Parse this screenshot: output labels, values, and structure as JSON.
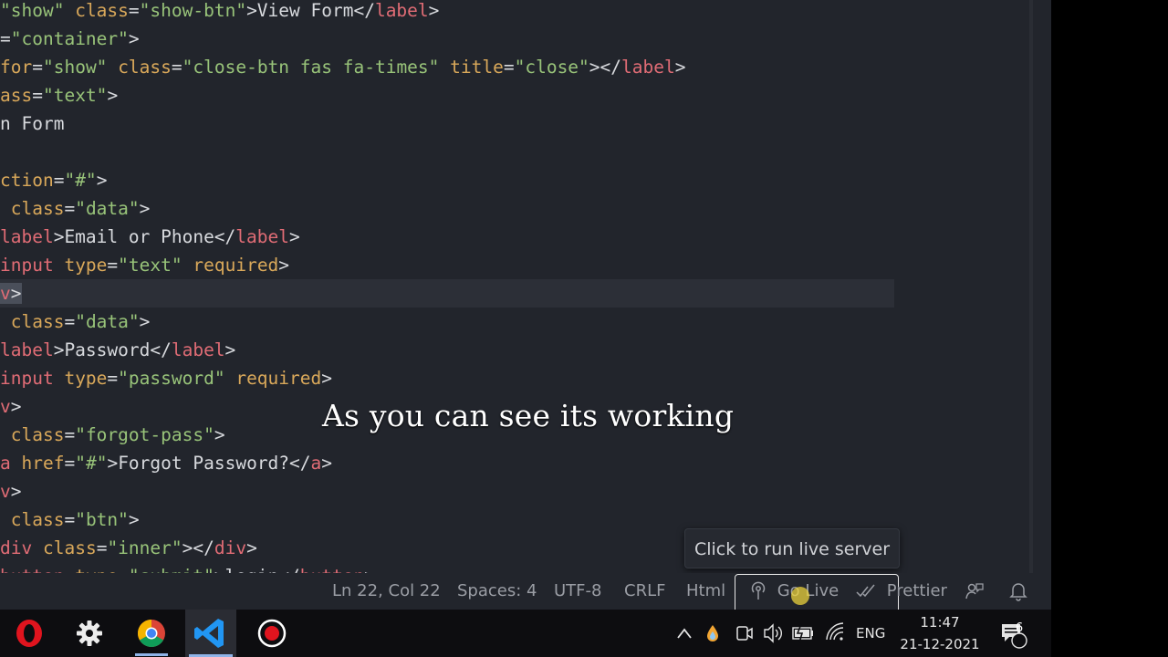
{
  "code_lines": [
    {
      "tokens": [
        {
          "c": "t-str",
          "t": "\"show\""
        },
        {
          "c": "t-txt",
          "t": " "
        },
        {
          "c": "t-attr",
          "t": "class"
        },
        {
          "c": "t-punc",
          "t": "="
        },
        {
          "c": "t-str",
          "t": "\"show-btn\""
        },
        {
          "c": "t-punc",
          "t": ">View Form</"
        },
        {
          "c": "t-tag",
          "t": "label"
        },
        {
          "c": "t-punc",
          "t": ">"
        }
      ]
    },
    {
      "tokens": [
        {
          "c": "t-punc",
          "t": "="
        },
        {
          "c": "t-str",
          "t": "\"container\""
        },
        {
          "c": "t-punc",
          "t": ">"
        }
      ]
    },
    {
      "tokens": [
        {
          "c": "t-attr",
          "t": "for"
        },
        {
          "c": "t-punc",
          "t": "="
        },
        {
          "c": "t-str",
          "t": "\"show\""
        },
        {
          "c": "t-txt",
          "t": " "
        },
        {
          "c": "t-attr",
          "t": "class"
        },
        {
          "c": "t-punc",
          "t": "="
        },
        {
          "c": "t-str",
          "t": "\"close-btn fas fa-times\""
        },
        {
          "c": "t-txt",
          "t": " "
        },
        {
          "c": "t-attr",
          "t": "title"
        },
        {
          "c": "t-punc",
          "t": "="
        },
        {
          "c": "t-str",
          "t": "\"close\""
        },
        {
          "c": "t-punc",
          "t": "></"
        },
        {
          "c": "t-tag",
          "t": "label"
        },
        {
          "c": "t-punc",
          "t": ">"
        }
      ]
    },
    {
      "tokens": [
        {
          "c": "t-attr",
          "t": "ass"
        },
        {
          "c": "t-punc",
          "t": "="
        },
        {
          "c": "t-str",
          "t": "\"text\""
        },
        {
          "c": "t-punc",
          "t": ">"
        }
      ]
    },
    {
      "tokens": [
        {
          "c": "t-txt",
          "t": "n Form"
        }
      ]
    },
    {
      "tokens": []
    },
    {
      "tokens": [
        {
          "c": "t-attr",
          "t": "ction"
        },
        {
          "c": "t-punc",
          "t": "="
        },
        {
          "c": "t-str",
          "t": "\"#\""
        },
        {
          "c": "t-punc",
          "t": ">"
        }
      ]
    },
    {
      "tokens": [
        {
          "c": "t-txt",
          "t": " "
        },
        {
          "c": "t-attr",
          "t": "class"
        },
        {
          "c": "t-punc",
          "t": "="
        },
        {
          "c": "t-str",
          "t": "\"data\""
        },
        {
          "c": "t-punc",
          "t": ">"
        }
      ]
    },
    {
      "tokens": [
        {
          "c": "t-tag",
          "t": "label"
        },
        {
          "c": "t-punc",
          "t": ">Email or Phone</"
        },
        {
          "c": "t-tag",
          "t": "label"
        },
        {
          "c": "t-punc",
          "t": ">"
        }
      ]
    },
    {
      "tokens": [
        {
          "c": "t-tag",
          "t": "input"
        },
        {
          "c": "t-txt",
          "t": " "
        },
        {
          "c": "t-attr",
          "t": "type"
        },
        {
          "c": "t-punc",
          "t": "="
        },
        {
          "c": "t-str",
          "t": "\"text\""
        },
        {
          "c": "t-txt",
          "t": " "
        },
        {
          "c": "t-attr",
          "t": "required"
        },
        {
          "c": "t-punc",
          "t": ">"
        }
      ]
    },
    {
      "active": true,
      "tokens": [
        {
          "c": "t-tag sel",
          "t": "v"
        },
        {
          "c": "t-punc sel",
          "t": ">"
        }
      ]
    },
    {
      "tokens": [
        {
          "c": "t-txt",
          "t": " "
        },
        {
          "c": "t-attr",
          "t": "class"
        },
        {
          "c": "t-punc",
          "t": "="
        },
        {
          "c": "t-str",
          "t": "\"data\""
        },
        {
          "c": "t-punc",
          "t": ">"
        }
      ]
    },
    {
      "tokens": [
        {
          "c": "t-tag",
          "t": "label"
        },
        {
          "c": "t-punc",
          "t": ">Password</"
        },
        {
          "c": "t-tag",
          "t": "label"
        },
        {
          "c": "t-punc",
          "t": ">"
        }
      ]
    },
    {
      "tokens": [
        {
          "c": "t-tag",
          "t": "input"
        },
        {
          "c": "t-txt",
          "t": " "
        },
        {
          "c": "t-attr",
          "t": "type"
        },
        {
          "c": "t-punc",
          "t": "="
        },
        {
          "c": "t-str",
          "t": "\"password\""
        },
        {
          "c": "t-txt",
          "t": " "
        },
        {
          "c": "t-attr",
          "t": "required"
        },
        {
          "c": "t-punc",
          "t": ">"
        }
      ]
    },
    {
      "tokens": [
        {
          "c": "t-tag",
          "t": "v"
        },
        {
          "c": "t-punc",
          "t": ">"
        }
      ]
    },
    {
      "tokens": [
        {
          "c": "t-txt",
          "t": " "
        },
        {
          "c": "t-attr",
          "t": "class"
        },
        {
          "c": "t-punc",
          "t": "="
        },
        {
          "c": "t-str",
          "t": "\"forgot-pass\""
        },
        {
          "c": "t-punc",
          "t": ">"
        }
      ]
    },
    {
      "tokens": [
        {
          "c": "t-tag",
          "t": "a"
        },
        {
          "c": "t-txt",
          "t": " "
        },
        {
          "c": "t-attr",
          "t": "href"
        },
        {
          "c": "t-punc",
          "t": "="
        },
        {
          "c": "t-str",
          "t": "\"#\""
        },
        {
          "c": "t-punc",
          "t": ">Forgot Password?</"
        },
        {
          "c": "t-tag",
          "t": "a"
        },
        {
          "c": "t-punc",
          "t": ">"
        }
      ]
    },
    {
      "tokens": [
        {
          "c": "t-tag",
          "t": "v"
        },
        {
          "c": "t-punc",
          "t": ">"
        }
      ]
    },
    {
      "tokens": [
        {
          "c": "t-txt",
          "t": " "
        },
        {
          "c": "t-attr",
          "t": "class"
        },
        {
          "c": "t-punc",
          "t": "="
        },
        {
          "c": "t-str",
          "t": "\"btn\""
        },
        {
          "c": "t-punc",
          "t": ">"
        }
      ]
    },
    {
      "tokens": [
        {
          "c": "t-tag",
          "t": "div"
        },
        {
          "c": "t-txt",
          "t": " "
        },
        {
          "c": "t-attr",
          "t": "class"
        },
        {
          "c": "t-punc",
          "t": "="
        },
        {
          "c": "t-str",
          "t": "\"inner\""
        },
        {
          "c": "t-punc",
          "t": "></"
        },
        {
          "c": "t-tag",
          "t": "div"
        },
        {
          "c": "t-punc",
          "t": ">"
        }
      ]
    },
    {
      "tokens": [
        {
          "c": "t-tag",
          "t": "button"
        },
        {
          "c": "t-txt",
          "t": " "
        },
        {
          "c": "t-attr",
          "t": "type"
        },
        {
          "c": "t-punc",
          "t": "="
        },
        {
          "c": "t-str",
          "t": "\"submit\""
        },
        {
          "c": "t-punc",
          "t": ">login</"
        },
        {
          "c": "t-tag",
          "t": "button"
        },
        {
          "c": "t-punc",
          "t": ">"
        }
      ]
    }
  ],
  "caption": "As you can see its working",
  "tooltip": "Click to run live server",
  "status": {
    "position": "Ln 22, Col 22",
    "spaces": "Spaces: 4",
    "encoding": "UTF-8",
    "eol": "CRLF",
    "language": "Html",
    "go_live": "Go Live",
    "prettier": "Prettier"
  },
  "tray": {
    "language": "ENG",
    "time": "11:47",
    "date": "21-12-2021",
    "notifications": "6"
  },
  "colors": {
    "editor_bg": "#22252c",
    "string": "#98c379",
    "attribute": "#d9a85a",
    "tag": "#e06c75"
  }
}
